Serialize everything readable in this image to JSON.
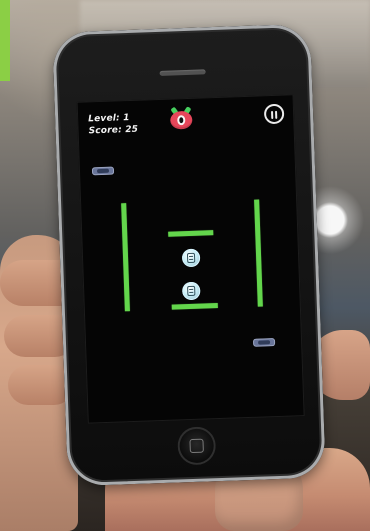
{
  "hud": {
    "level_text": "Level: 1",
    "score_text": "Score: 25"
  },
  "colors": {
    "accent_green": "#63d64c",
    "enemy_red": "#e6465a",
    "enemy_green": "#46d05f",
    "pause_white": "#ececec",
    "token_blue": "#7c8ab6",
    "ball_light": "#c8eef7"
  },
  "icons": {
    "pause": "pause-icon",
    "enemy": "red-monster-icon",
    "ball": "light-blue-ball-icon",
    "token": "small-capsule-icon",
    "home": "home-button-square-icon"
  }
}
